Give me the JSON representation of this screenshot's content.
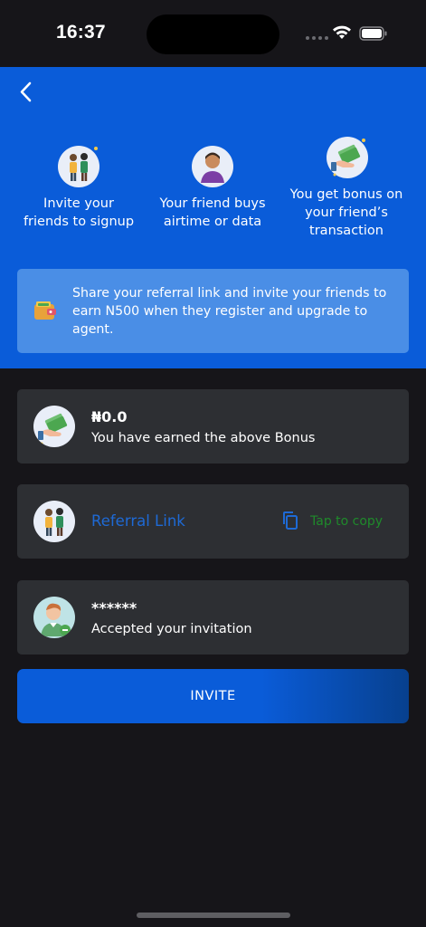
{
  "status_bar": {
    "time": "16:37"
  },
  "steps": [
    {
      "label": "Invite your friends to signup",
      "icon": "friends-icon"
    },
    {
      "label": "Your friend buys airtime or data",
      "icon": "person-icon"
    },
    {
      "label": "You get bonus on your friend’s transaction",
      "icon": "cash-hand-icon"
    }
  ],
  "info": {
    "text": "Share your referral link and invite your friends to earn N500 when they register and upgrade to agent.",
    "icon": "wallet-icon"
  },
  "bonus_card": {
    "amount": "₦0.0",
    "subtitle": "You have earned the above Bonus"
  },
  "referral_card": {
    "label": "Referral Link",
    "copy_label": "Tap to copy"
  },
  "invitation_card": {
    "name": "******",
    "subtitle": "Accepted your invitation"
  },
  "invite_button": {
    "label": "INVITE"
  },
  "colors": {
    "primary": "#0A5CD9",
    "background": "#161519",
    "card": "#2D2F33",
    "link": "#1E6AD6",
    "copy": "#1F8A2B"
  }
}
